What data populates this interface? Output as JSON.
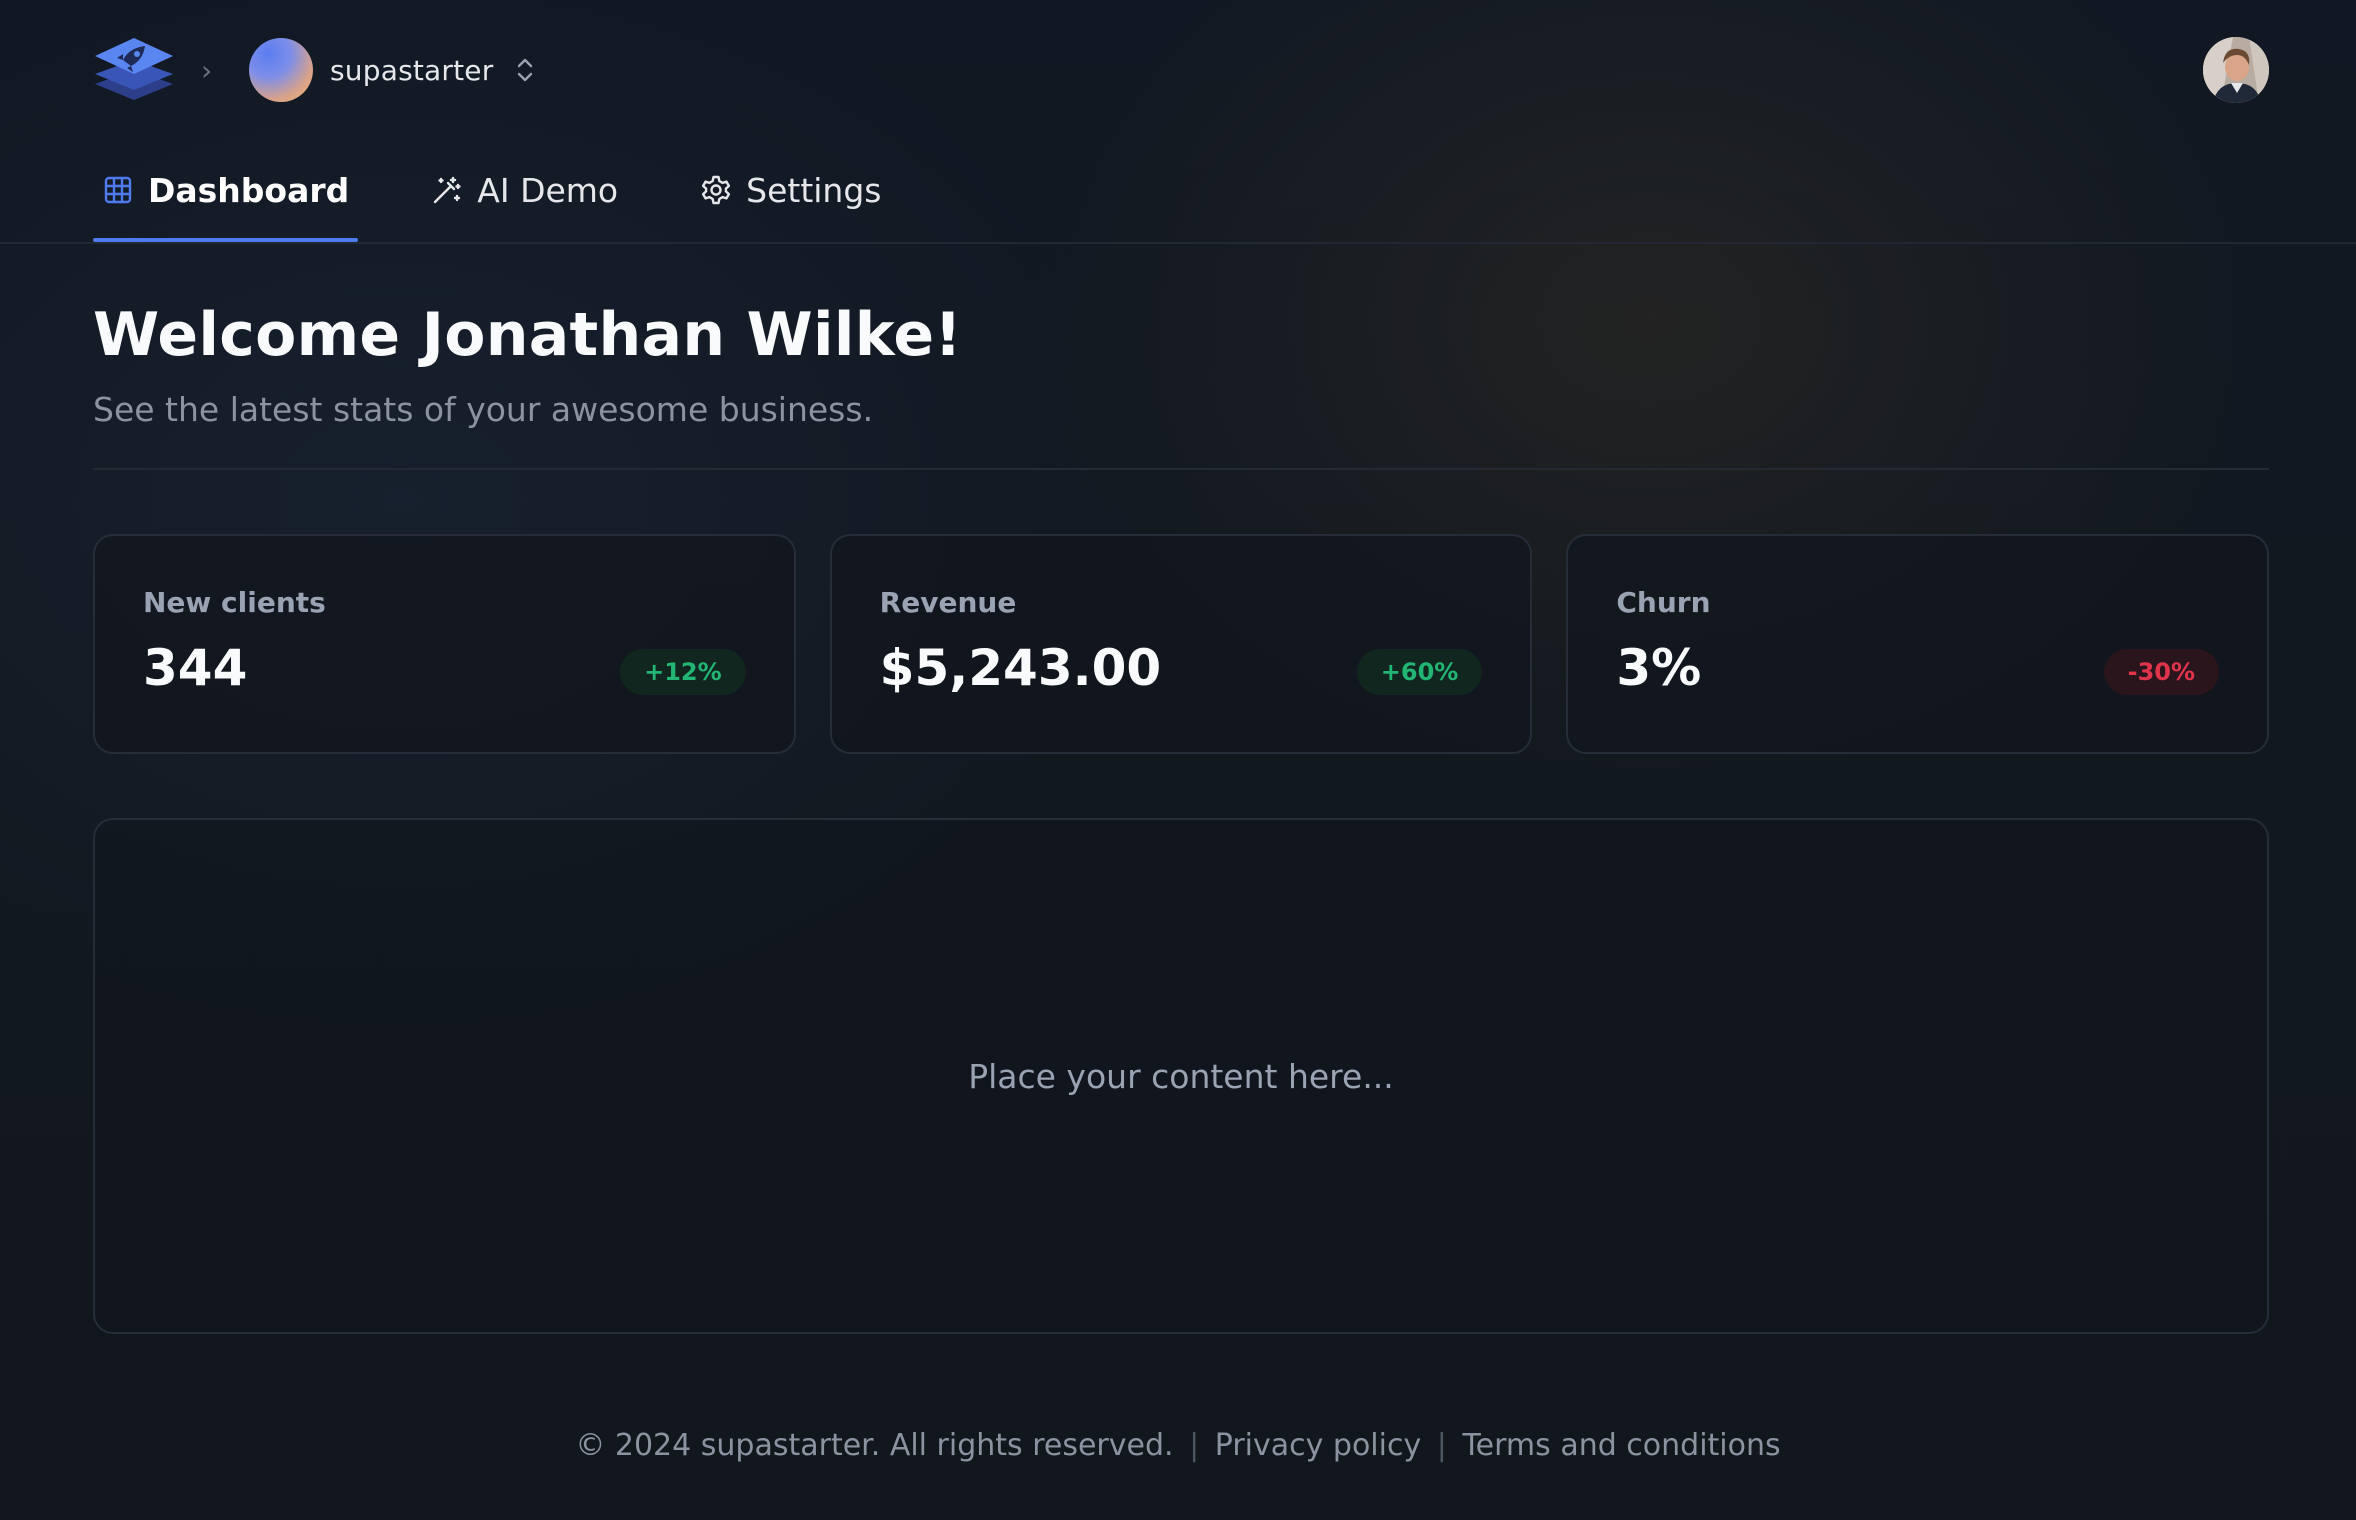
{
  "header": {
    "logo_icon": "rocket-stack-logo-icon",
    "breadcrumb_separator": "›",
    "org": {
      "name": "supastarter",
      "switch_icon": "chevrons-up-down-icon"
    },
    "user_avatar_icon": "user-avatar"
  },
  "nav": {
    "tabs": [
      {
        "label": "Dashboard",
        "icon": "grid-icon",
        "active": true
      },
      {
        "label": "AI Demo",
        "icon": "magic-wand-icon",
        "active": false
      },
      {
        "label": "Settings",
        "icon": "gear-icon",
        "active": false
      }
    ]
  },
  "welcome": {
    "title": "Welcome Jonathan Wilke!",
    "subtitle": "See the latest stats of your awesome business."
  },
  "stats": [
    {
      "label": "New clients",
      "value": "344",
      "change": "+12%",
      "trend": "up"
    },
    {
      "label": "Revenue",
      "value": "$5,243.00",
      "change": "+60%",
      "trend": "up"
    },
    {
      "label": "Churn",
      "value": "3%",
      "change": "-30%",
      "trend": "down"
    }
  ],
  "content": {
    "placeholder": "Place your content here..."
  },
  "footer": {
    "copyright": "© 2024 supastarter. All rights reserved.",
    "separator": "|",
    "privacy_label": "Privacy policy",
    "terms_label": "Terms and conditions"
  },
  "colors": {
    "accent": "#4f7bf0",
    "positive": "#22b573",
    "negative": "#e0344d",
    "background": "#0f141b"
  }
}
